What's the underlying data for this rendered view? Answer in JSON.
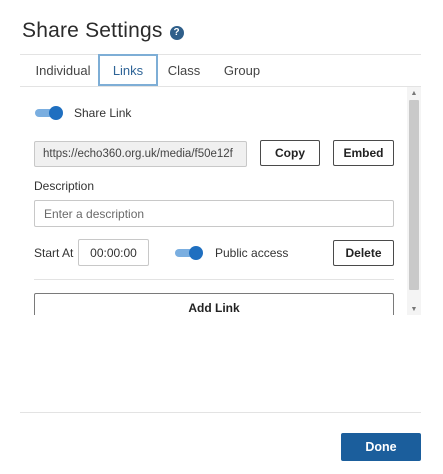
{
  "header": {
    "title": "Share Settings",
    "help_icon": "?"
  },
  "tabs": [
    {
      "label": "Individual",
      "active": false
    },
    {
      "label": "Links",
      "active": true
    },
    {
      "label": "Class",
      "active": false
    },
    {
      "label": "Group",
      "active": false
    }
  ],
  "link": {
    "share_toggle_on": true,
    "share_label": "Share Link",
    "url": "https://echo360.org.uk/media/f50e12f",
    "copy_label": "Copy",
    "embed_label": "Embed",
    "description_label": "Description",
    "description_placeholder": "Enter a description",
    "start_at_label": "Start At",
    "start_at_value": "00:00:00",
    "public_toggle_on": true,
    "public_label": "Public access",
    "delete_label": "Delete"
  },
  "add_link_label": "Add Link",
  "scrollbar": {
    "up_icon": "▲",
    "down_icon": "▼"
  },
  "footer": {
    "done_label": "Done"
  },
  "colors": {
    "primary": "#1b5e9c",
    "toggle_knob": "#1f6fc0",
    "active_tab_border": "#7eaed6"
  }
}
